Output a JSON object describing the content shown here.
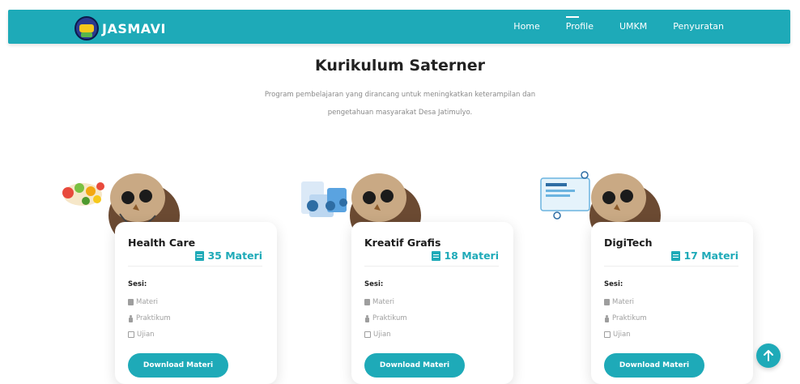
{
  "brand": {
    "name": "JASMAVI"
  },
  "nav": {
    "items": [
      {
        "label": "Home"
      },
      {
        "label": "Profile"
      },
      {
        "label": "UMKM"
      },
      {
        "label": "Penyuratan"
      }
    ]
  },
  "hero": {
    "title": "Kurikulum Saterner",
    "subtitle_line1": "Program pembelajaran yang dirancang untuk meningkatkan keterampilan dan",
    "subtitle_line2": "pengetahuan masyarakat Desa Jatimulyo."
  },
  "cards": [
    {
      "title": "Health Care",
      "count": "35 Materi",
      "sesi_label": "Sesi:",
      "items": [
        "Materi",
        "Praktikum",
        "Ujian"
      ],
      "button": "Download Materi"
    },
    {
      "title": "Kreatif Grafis",
      "count": "18 Materi",
      "sesi_label": "Sesi:",
      "items": [
        "Materi",
        "Praktikum",
        "Ujian"
      ],
      "button": "Download Materi"
    },
    {
      "title": "DigiTech",
      "count": "17 Materi",
      "sesi_label": "Sesi:",
      "items": [
        "Materi",
        "Praktikum",
        "Ujian"
      ],
      "button": "Download Materi"
    }
  ],
  "colors": {
    "primary": "#1eaab8",
    "text": "#222222",
    "muted": "#8a8a8a"
  },
  "icons": {
    "scroll_top": "arrow-up-icon",
    "count": "book-icon"
  }
}
